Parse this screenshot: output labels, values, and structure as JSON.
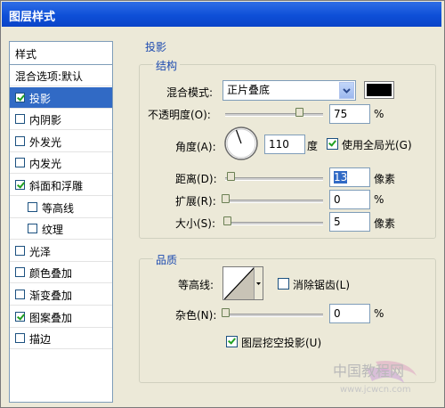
{
  "window": {
    "title": "图层样式"
  },
  "left_panel": {
    "header": "样式",
    "items": [
      {
        "label": "混合选项:默认",
        "checkbox": false,
        "checked": false
      },
      {
        "label": "投影",
        "checkbox": true,
        "checked": true,
        "selected": true
      },
      {
        "label": "内阴影",
        "checkbox": true,
        "checked": false
      },
      {
        "label": "外发光",
        "checkbox": true,
        "checked": false
      },
      {
        "label": "内发光",
        "checkbox": true,
        "checked": false
      },
      {
        "label": "斜面和浮雕",
        "checkbox": true,
        "checked": true
      },
      {
        "label": "等高线",
        "checkbox": true,
        "checked": false,
        "indent": true
      },
      {
        "label": "纹理",
        "checkbox": true,
        "checked": false,
        "indent": true
      },
      {
        "label": "光泽",
        "checkbox": true,
        "checked": false
      },
      {
        "label": "颜色叠加",
        "checkbox": true,
        "checked": false
      },
      {
        "label": "渐变叠加",
        "checkbox": true,
        "checked": false
      },
      {
        "label": "图案叠加",
        "checkbox": true,
        "checked": true
      },
      {
        "label": "描边",
        "checkbox": true,
        "checked": false
      }
    ]
  },
  "drop_shadow": {
    "section_title": "投影",
    "structure_title": "结构",
    "blend_mode_label": "混合模式:",
    "blend_mode_value": "正片叠底",
    "shadow_color": "#000000",
    "opacity_label": "不透明度(O):",
    "opacity_value": "75",
    "opacity_slider": 0.75,
    "opacity_unit": "%",
    "angle_label": "角度(A):",
    "angle_value": "110",
    "angle_unit": "度",
    "global_light_label": "使用全局光(G)",
    "global_light_checked": true,
    "distance_label": "距离(D):",
    "distance_value": "13",
    "distance_slider": 0.05,
    "distance_unit": "像素",
    "spread_label": "扩展(R):",
    "spread_value": "0",
    "spread_slider": 0.0,
    "spread_unit": "%",
    "size_label": "大小(S):",
    "size_value": "5",
    "size_slider": 0.02,
    "size_unit": "像素"
  },
  "quality": {
    "title": "品质",
    "contour_label": "等高线:",
    "anti_alias_label": "消除锯齿(L)",
    "anti_alias_checked": false,
    "noise_label": "杂色(N):",
    "noise_value": "0",
    "noise_slider": 0.0,
    "noise_unit": "%",
    "knockout_label": "图层挖空投影(U)",
    "knockout_checked": true
  },
  "watermark": "中国教程网 www.jcwcn.com"
}
